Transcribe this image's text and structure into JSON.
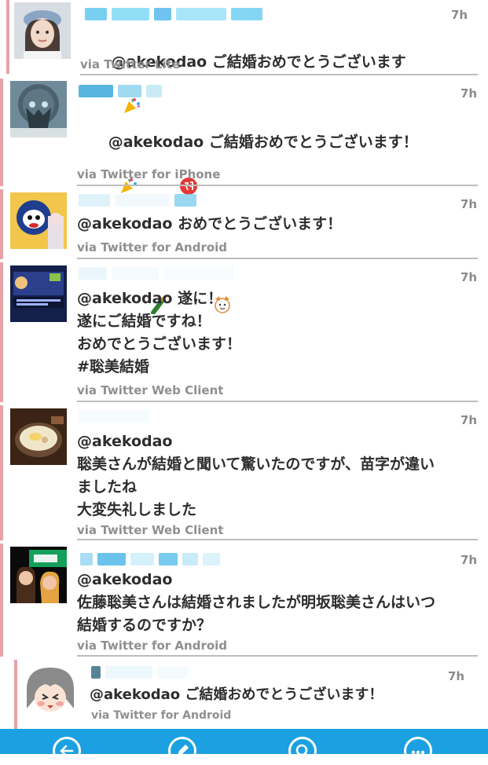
{
  "tweets": [
    {
      "time": "7h",
      "text": "@akekodao ご結婚おめでとうございます",
      "emoji": [
        "party-popper"
      ],
      "via": "via Twitter Lite",
      "avatar": "girl-in-cap"
    },
    {
      "time": "7h",
      "text": "@akekodao ご結婚おめでとうございます！",
      "emoji": [
        "party-popper",
        "congratulations-badge",
        "champagne",
        "celebration-face"
      ],
      "via": "via Twitter for iPhone",
      "avatar": "anime-robot"
    },
    {
      "time": "7h",
      "text": "@akekodao おめでとうございます！",
      "via": "via Twitter for Android",
      "avatar": "mascot"
    },
    {
      "time": "7h",
      "text": "@akekodao 遂に！\n遂にご結婚ですね！\nおめでとうございます！\n#聡美結婚",
      "via": "via Twitter Web Client",
      "avatar": "game-screen"
    },
    {
      "time": "7h",
      "text": "@akekodao\n聡美さんが結婚と聞いて驚いたのですが、苗字が違い\nましたね\n大変失礼しました",
      "via": "via Twitter Web Client",
      "avatar": "food-bowl"
    },
    {
      "time": "7h",
      "text": "@akekodao\n佐藤聡美さんは結婚されましたが明坂聡美さんはいつ\n結婚するのですか？",
      "via": "via Twitter for Android",
      "avatar": "stage-photo"
    },
    {
      "time": "7h",
      "text": "@akekodao ご結婚おめでとうございます！",
      "via": "via Twitter for Android",
      "avatar": "anime-girl-blush"
    }
  ],
  "colors": {
    "accent": "#e7a2a8",
    "appbar": "#1ba1e2",
    "via": "#8f8f8f",
    "divider": "#bdbdbd"
  },
  "appbar": [
    "back-icon",
    "compose-icon",
    "search-icon",
    "more-icon"
  ]
}
